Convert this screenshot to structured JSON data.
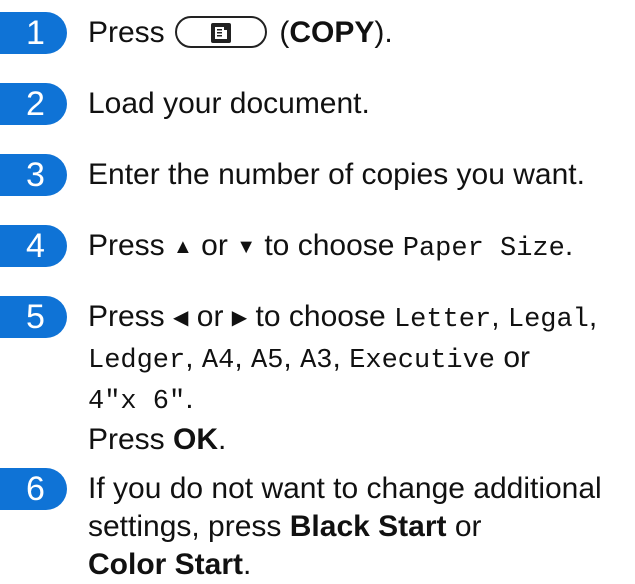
{
  "steps": [
    {
      "number": "1",
      "press_word": "Press",
      "button_icon": "copy-icon",
      "open_paren": "(",
      "copy_label": "COPY",
      "close_paren": ")."
    },
    {
      "number": "2",
      "text": "Load your document."
    },
    {
      "number": "3",
      "text": "Enter the number of copies you want."
    },
    {
      "number": "4",
      "press_word": "Press",
      "up_symbol": "▲",
      "or_word": "or",
      "down_symbol": "▼",
      "to_choose": "to choose",
      "menu_item": "Paper Size",
      "period": "."
    },
    {
      "number": "5",
      "press_word": "Press",
      "left_symbol": "◀",
      "or_word": "or",
      "right_symbol": "▶",
      "to_choose": "to choose",
      "opt_letter": "Letter",
      "comma1": ",",
      "opt_legal": "Legal",
      "comma2": ",",
      "opt_ledger": "Ledger",
      "comma3": ",",
      "opt_a4": "A4",
      "comma4": ",",
      "opt_a5": "A5",
      "comma5": ",",
      "opt_a3": "A3",
      "comma6": ",",
      "opt_executive": "Executive",
      "or_word2": "or",
      "opt_4x6": "4\"x 6\"",
      "period": ".",
      "press_word2": "Press",
      "ok_label": "OK",
      "period2": "."
    },
    {
      "number": "6",
      "line1": "If you do not want to change additional",
      "line2_prefix": "settings, press",
      "black_start": "Black Start",
      "or_word": "or",
      "color_start": "Color Start",
      "period": "."
    }
  ]
}
